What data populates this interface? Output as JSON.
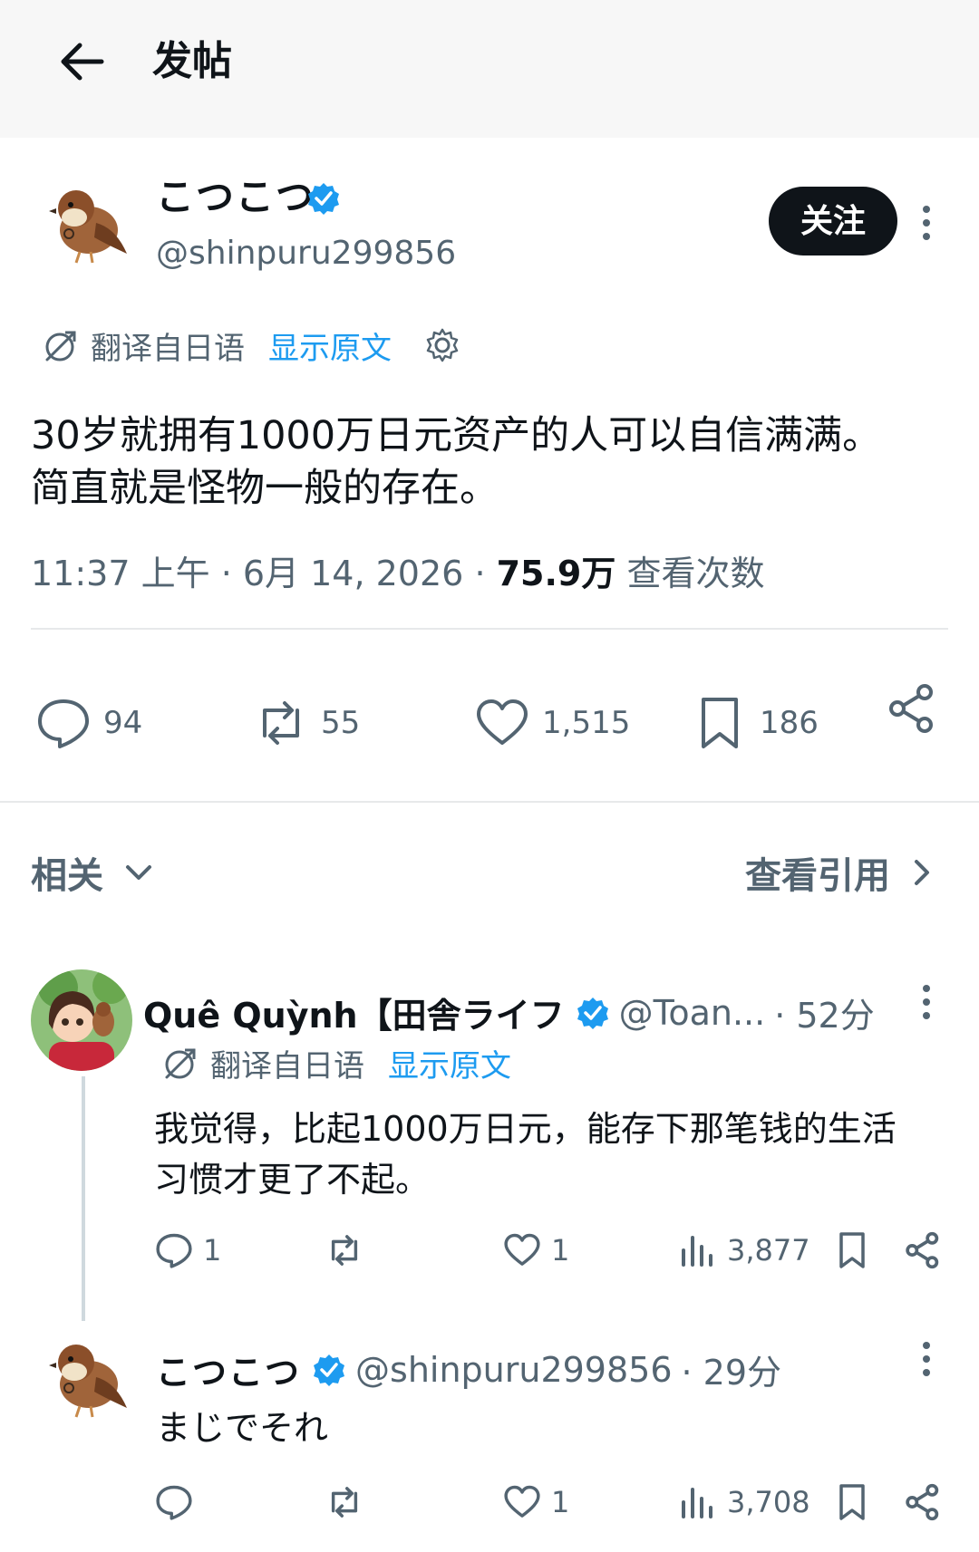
{
  "header": {
    "title": "发帖",
    "back_icon": "arrow-left-icon"
  },
  "post": {
    "author_name": "こつこつ",
    "author_handle": "@shinpuru299856",
    "follow_label": "关注",
    "translate_label": "翻译自日语",
    "show_original_label": "显示原文",
    "text_line1": "30岁就拥有1000万日元资产的人可以自信满满。",
    "text_line2": "简直就是怪物一般的存在。",
    "time": "11:37 上午",
    "date": "6月 14, 2026",
    "views": "75.9万",
    "views_label": "查看次数",
    "replies": "94",
    "reposts": "55",
    "likes": "1,515",
    "bookmarks": "186"
  },
  "related": {
    "label": "相关",
    "quotes_label": "查看引用"
  },
  "replies": [
    {
      "name": "Quê Quỳnh【田舎ライフ",
      "handle": "@Toan...",
      "time": "· 52分",
      "translate_label": "翻译自日语",
      "show_original_label": "显示原文",
      "text_line1": "我觉得，比起1000万日元，能存下那笔钱的生活",
      "text_line2": "习惯才更了不起。",
      "replies": "1",
      "likes": "1",
      "views": "3,877"
    },
    {
      "name": "こつこつ",
      "handle": "@shinpuru299856",
      "time": "· 29分",
      "text_line1": "まじでそれ",
      "likes": "1",
      "views": "3,708"
    }
  ],
  "colors": {
    "accent": "#1d9bf0",
    "text": "#0f1419",
    "muted": "#536471",
    "divider": "#e7e9ea"
  }
}
